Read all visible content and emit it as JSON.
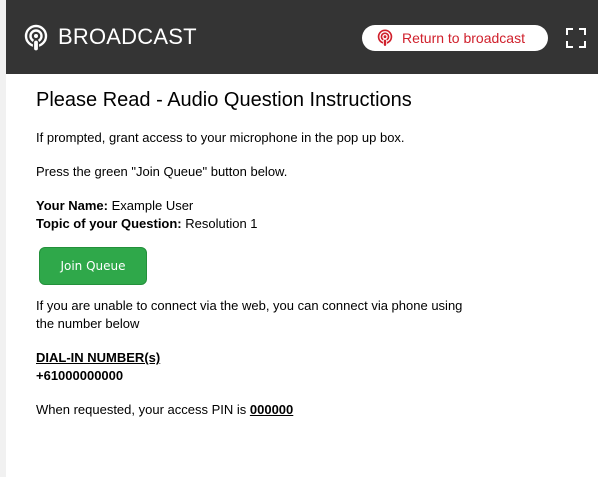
{
  "header": {
    "title": "BROADCAST",
    "brand_icon": "podcast-icon",
    "return_label": "Return to broadcast",
    "return_icon": "podcast-icon",
    "fullscreen_icon": "fullscreen-icon",
    "background_color": "#343434",
    "accent_color": "#d0202c"
  },
  "main": {
    "title": "Please Read - Audio Question Instructions",
    "instruction_1": "If prompted, grant access to your microphone in the pop up box.",
    "instruction_2": "Press the green \"Join Queue\" button below.",
    "name_label": "Your Name:",
    "name_value": "Example User",
    "topic_label": "Topic of your Question:",
    "topic_value": "Resolution 1",
    "join_button": "Join Queue",
    "join_button_color": "#2fa84a",
    "fallback_text": "If you are unable to connect via the web, you can connect via phone using the number below",
    "dial_in_heading": "DIAL-IN NUMBER(s)",
    "dial_in_number": "+61000000000",
    "pin_text": "When requested, your access PIN is",
    "pin_value": "000000"
  }
}
